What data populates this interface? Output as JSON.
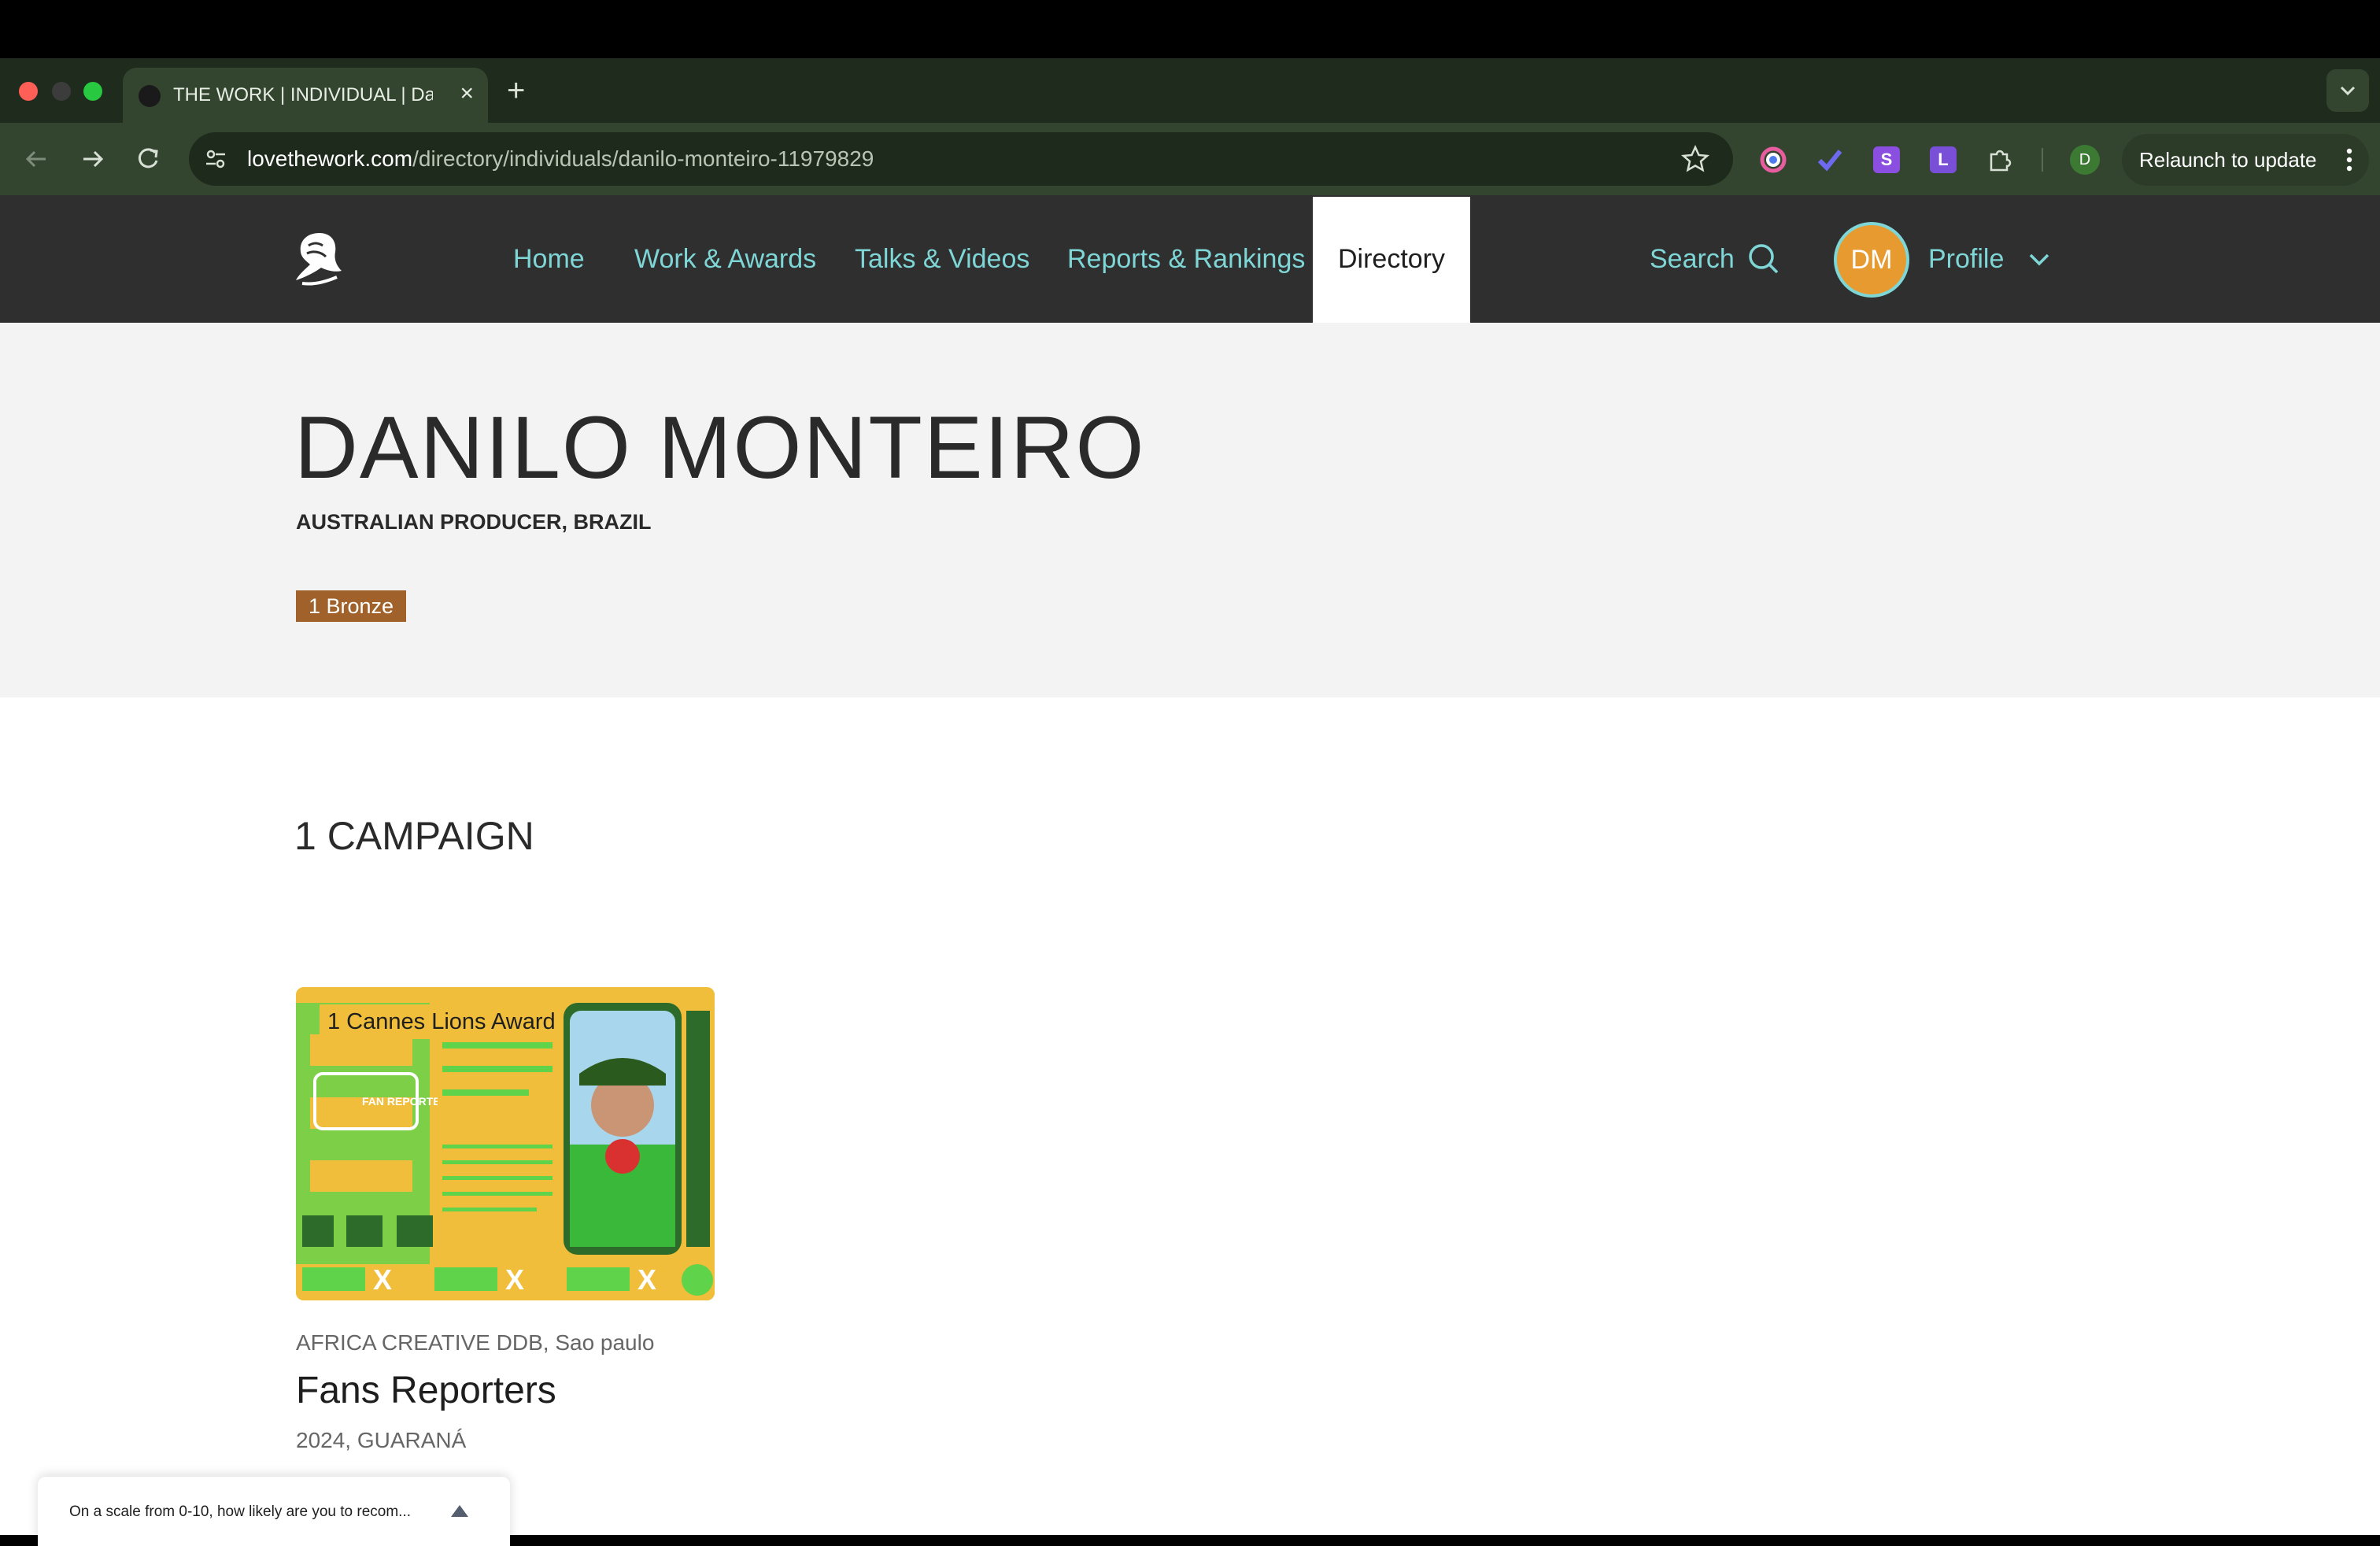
{
  "browser": {
    "tab_title": "THE WORK | INDIVIDUAL | Danilo Monteiro",
    "new_tab_label": "+",
    "url_host": "lovethework.com",
    "url_path": "/directory/individuals/danilo-monteiro-11979829",
    "profile_initial": "D",
    "relaunch_label": "Relaunch to update",
    "extensions": [
      {
        "icon": "color-circle-icon",
        "color": "#4b7bec"
      },
      {
        "icon": "checkmark-icon",
        "color": "#6e6af0"
      },
      {
        "icon": "s-extension-icon",
        "letter": "S",
        "color": "#8a4fe0"
      },
      {
        "icon": "l-extension-icon",
        "letter": "L",
        "color": "#7a4fd8"
      },
      {
        "icon": "puzzle-icon",
        "color": "#d9e0d6"
      }
    ]
  },
  "site": {
    "nav": {
      "home": "Home",
      "work_awards": "Work & Awards",
      "talks_videos": "Talks & Videos",
      "reports_rankings": "Reports & Rankings",
      "directory": "Directory"
    },
    "search_label": "Search",
    "avatar_initials": "DM",
    "profile_label": "Profile",
    "accent_color": "#7fd6d6"
  },
  "individual": {
    "name": "DANILO MONTEIRO",
    "role": "AUSTRALIAN PRODUCER, BRAZIL",
    "award_badge": "1 Bronze",
    "badge_color": "#a0622a"
  },
  "campaigns": {
    "heading": "1 CAMPAIGN",
    "items": [
      {
        "award_label": "1 Cannes Lions Award",
        "agency": "AFRICA CREATIVE DDB, Sao paulo",
        "title": "Fans Reporters",
        "meta": "2024, GUARANÁ",
        "image_brand_text": "FAN REPORTERS"
      }
    ]
  },
  "survey": {
    "text": "On a scale from 0-10, how likely are you to recom..."
  }
}
